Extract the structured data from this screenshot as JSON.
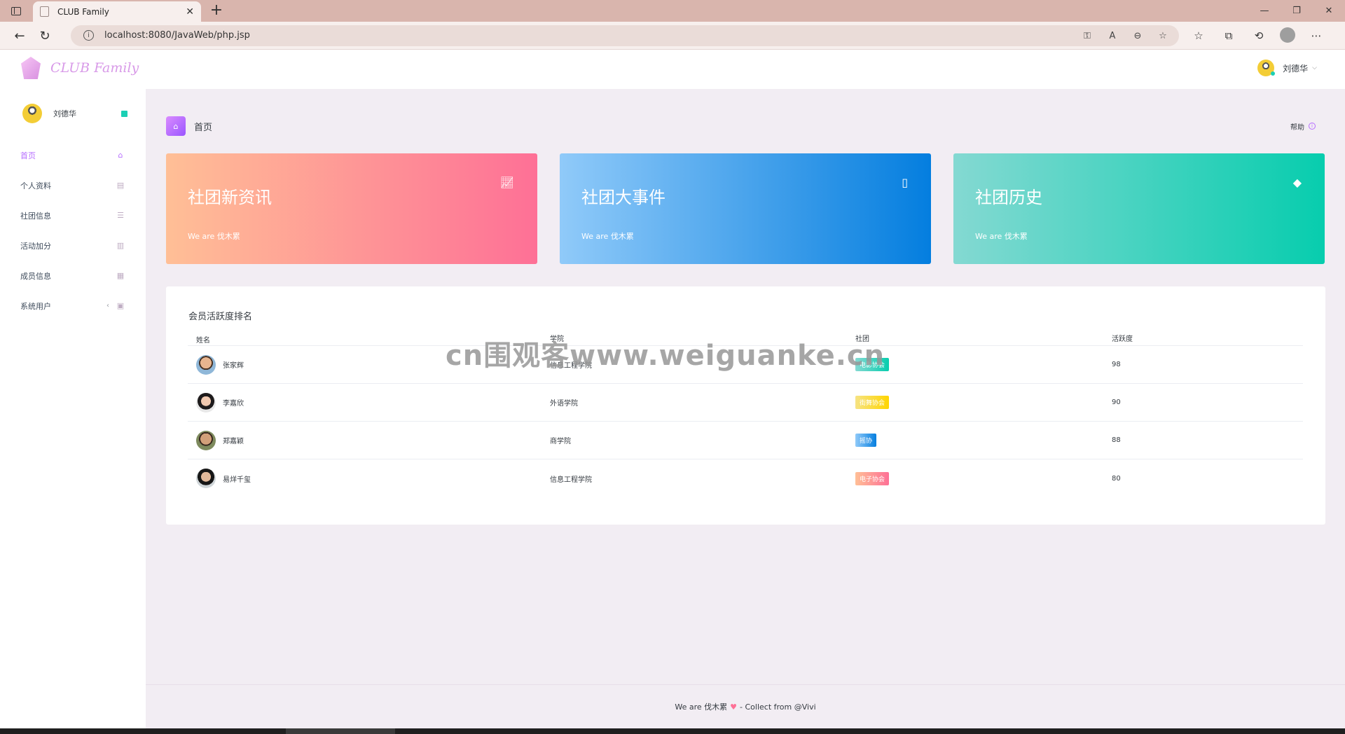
{
  "browser": {
    "tab_title": "CLUB Family",
    "url": "localhost:8080/JavaWeb/php.jsp",
    "new_tab": "+",
    "tab_close": "✕"
  },
  "navbar": {
    "logo_text": "CLUB Family",
    "user_name": "刘德华"
  },
  "sidebar": {
    "profile_name": "刘德华",
    "items": [
      {
        "label": "首页",
        "icon": "home-icon",
        "active": true
      },
      {
        "label": "个人资料",
        "icon": "contacts-icon"
      },
      {
        "label": "社团信息",
        "icon": "list-icon"
      },
      {
        "label": "活动加分",
        "icon": "chart-bar-icon"
      },
      {
        "label": "成员信息",
        "icon": "table-icon"
      },
      {
        "label": "系统用户",
        "icon": "lock-icon",
        "has_arrow": true
      }
    ]
  },
  "page_header": {
    "title": "首页",
    "help": "帮助"
  },
  "cards": [
    {
      "title": "社团新资讯",
      "subtitle": "We are 伐木累",
      "icon": "chart-line-icon"
    },
    {
      "title": "社团大事件",
      "subtitle": "We are 伐木累",
      "icon": "bookmark-icon"
    },
    {
      "title": "社团历史",
      "subtitle": "We are 伐木累",
      "icon": "diamond-icon"
    }
  ],
  "ranking": {
    "title": "会员活跃度排名",
    "columns": [
      "姓名",
      "学院",
      "社团",
      "活跃度"
    ],
    "rows": [
      {
        "name": "张家辉",
        "college": "信息工程学院",
        "club": "电影协会",
        "score": "98"
      },
      {
        "name": "李嘉欣",
        "college": "外语学院",
        "club": "街舞协会",
        "score": "90"
      },
      {
        "name": "郑嘉颖",
        "college": "商学院",
        "club": "摇协",
        "score": "88"
      },
      {
        "name": "易烊千玺",
        "college": "信息工程学院",
        "club": "电子协会",
        "score": "80"
      }
    ]
  },
  "footer": {
    "prefix": "We are 伐木累",
    "suffix": "- Collect from @Vivi"
  },
  "watermark": "cn围观客www.weiguanke.cn",
  "colors": {
    "accent": "#b66dff",
    "card1": [
      "#ffbf96",
      "#fe7096"
    ],
    "card2": [
      "#90caf9",
      "#047edf"
    ],
    "card3": [
      "#84d9d2",
      "#07cdae"
    ]
  }
}
